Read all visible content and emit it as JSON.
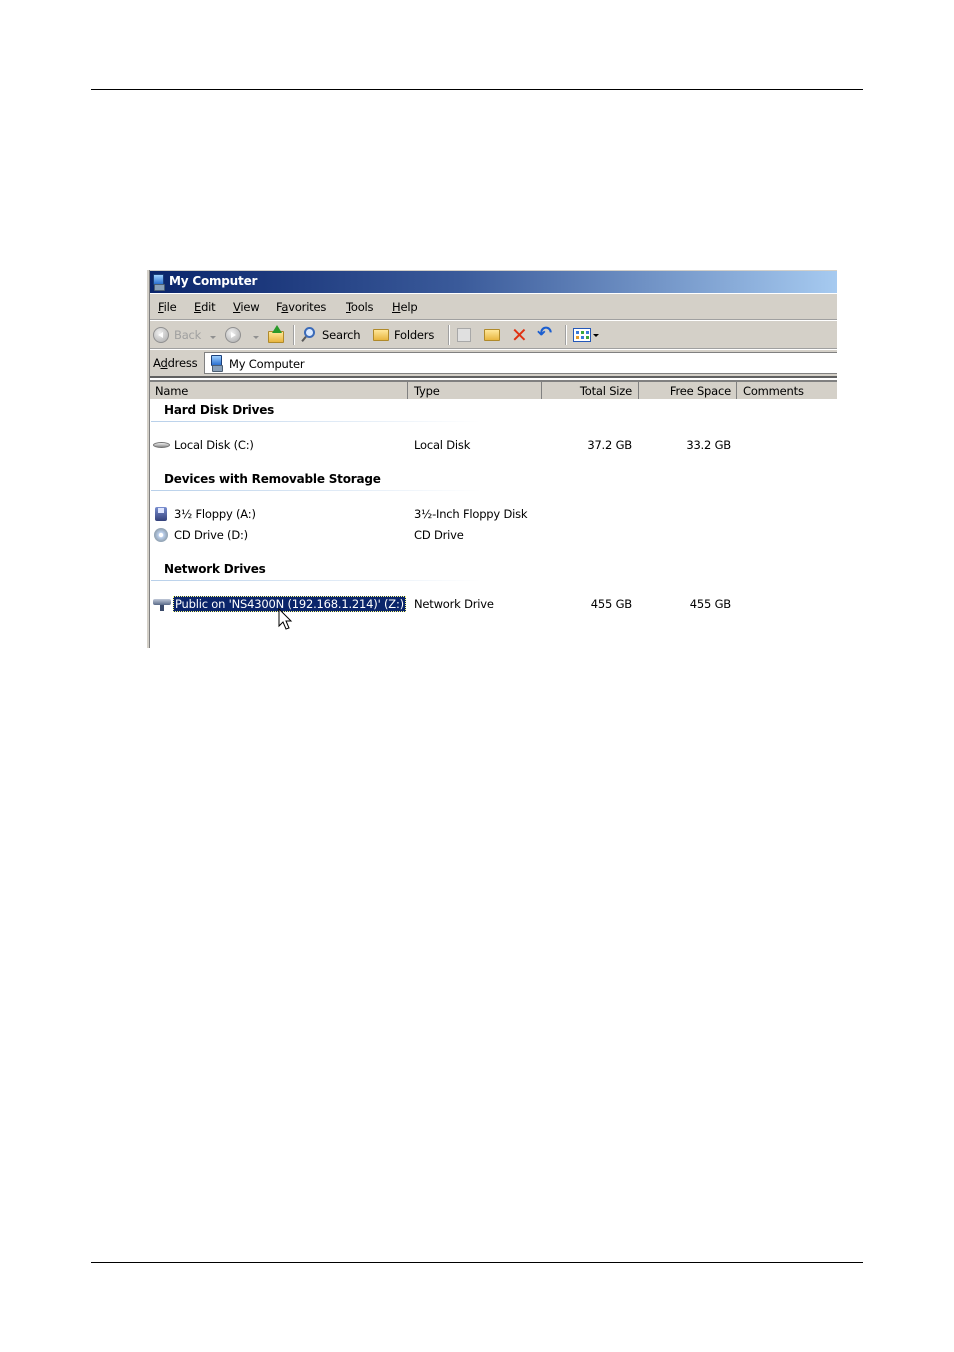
{
  "window": {
    "title": "My Computer",
    "title_icon": "my-computer-icon"
  },
  "menubar": {
    "items": [
      {
        "label": "File",
        "accel": "F"
      },
      {
        "label": "Edit",
        "accel": "E"
      },
      {
        "label": "View",
        "accel": "V"
      },
      {
        "label": "Favorites",
        "accel": "a"
      },
      {
        "label": "Tools",
        "accel": "T"
      },
      {
        "label": "Help",
        "accel": "H"
      }
    ]
  },
  "toolbar": {
    "back_label": "Back",
    "search_label": "Search",
    "folders_label": "Folders",
    "icons": [
      "back-icon",
      "forward-icon",
      "up-folder-icon",
      "search-icon",
      "folders-icon",
      "move-to-icon",
      "copy-to-icon",
      "delete-icon",
      "undo-icon",
      "views-icon"
    ]
  },
  "address": {
    "label": "Address",
    "value": "My Computer"
  },
  "columns": [
    {
      "label": "Name"
    },
    {
      "label": "Type"
    },
    {
      "label": "Total Size"
    },
    {
      "label": "Free Space"
    },
    {
      "label": "Comments"
    }
  ],
  "groups": [
    {
      "title": "Hard Disk Drives",
      "items": [
        {
          "name": "Local Disk (C:)",
          "type": "Local Disk",
          "total": "37.2 GB",
          "free": "33.2 GB",
          "icon": "hard-disk-icon"
        }
      ]
    },
    {
      "title": "Devices with Removable Storage",
      "items": [
        {
          "name": "3½ Floppy (A:)",
          "type": "3½-Inch Floppy Disk",
          "total": "",
          "free": "",
          "icon": "floppy-drive-icon"
        },
        {
          "name": "CD Drive (D:)",
          "type": "CD Drive",
          "total": "",
          "free": "",
          "icon": "cd-drive-icon"
        }
      ]
    },
    {
      "title": "Network Drives",
      "items": [
        {
          "name": "Public on 'NS4300N (192.168.1.214)' (Z:)",
          "type": "Network Drive",
          "total": "455 GB",
          "free": "455 GB",
          "icon": "network-drive-icon",
          "selected": true
        }
      ]
    }
  ],
  "colors": {
    "selection": "#0a246a",
    "titlebar_start": "#0a246a",
    "titlebar_end": "#a6caf0",
    "chrome": "#d4d0c8"
  }
}
